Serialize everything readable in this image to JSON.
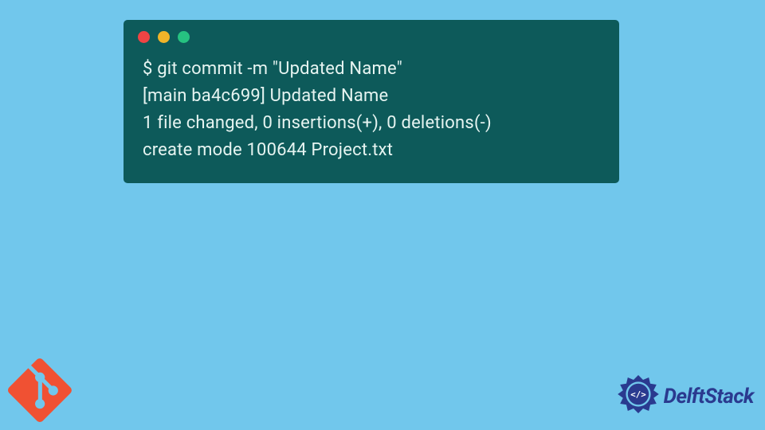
{
  "terminal": {
    "lines": [
      "$ git commit -m \"Updated Name\"",
      "[main ba4c699] Updated Name",
      " 1 file changed, 0 insertions(+), 0 deletions(-)",
      " create mode 100644 Project.txt"
    ]
  },
  "logos": {
    "git_name": "git-icon",
    "delft_text": "DelftStack"
  }
}
